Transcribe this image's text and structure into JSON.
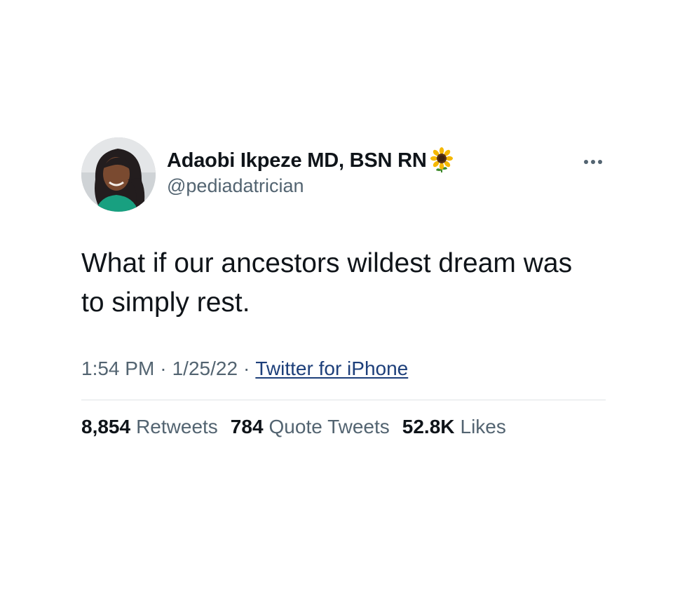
{
  "tweet": {
    "author": {
      "display_name": "Adaobi Ikpeze MD, BSN RN",
      "name_emoji": "sunflower-icon",
      "handle": "@pediadatrician"
    },
    "text": "What if our ancestors wildest dream was to simply rest.",
    "time": "1:54 PM",
    "date": "1/25/22",
    "separator": "·",
    "source": "Twitter for iPhone",
    "stats": [
      {
        "value": "8,854",
        "label": "Retweets"
      },
      {
        "value": "784",
        "label": "Quote Tweets"
      },
      {
        "value": "52.8K",
        "label": "Likes"
      }
    ]
  },
  "colors": {
    "text_primary": "#0f1419",
    "text_secondary": "#536471",
    "link": "#1d3f7a",
    "divider": "#dfe3e6"
  },
  "icons": {
    "more": "more-horizontal-icon",
    "avatar": "profile-photo"
  }
}
